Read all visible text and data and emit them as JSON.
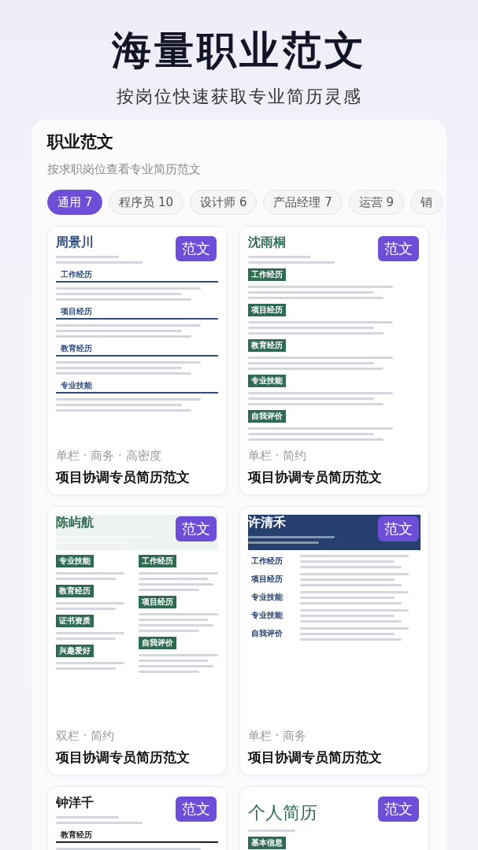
{
  "headline": "海量职业范文",
  "subheadline": "按岗位快速获取专业简历灵感",
  "panel": {
    "title": "职业范文",
    "subtitle": "按求职岗位查看专业简历范文",
    "tabs": [
      {
        "label": "通用 7",
        "selected": true
      },
      {
        "label": "程序员 10",
        "selected": false
      },
      {
        "label": "设计师 6",
        "selected": false
      },
      {
        "label": "产品经理 7",
        "selected": false
      },
      {
        "label": "运营 9",
        "selected": false
      },
      {
        "label": "销",
        "selected": false
      }
    ],
    "templates": [
      {
        "kind": "classic",
        "name": "周景川",
        "color": "#2f4d80",
        "badge": "范文",
        "sections": [
          "工作经历",
          "项目经历",
          "教育经历",
          "专业技能"
        ],
        "tags": "单栏 · 商务 · 高密度",
        "title": "项目协调专员简历范文"
      },
      {
        "kind": "chips",
        "name": "沈雨桐",
        "color": "#2e6b52",
        "badge": "范文",
        "sections": [
          "工作经历",
          "项目经历",
          "教育经历",
          "专业技能",
          "自我评价"
        ],
        "tags": "单栏 · 简约",
        "title": "项目协调专员简历范文"
      },
      {
        "kind": "two-column",
        "name": "陈屿航",
        "color": "#2e6b52",
        "badge": "范文",
        "sections": [
          "专业技能",
          "教育经历",
          "证书资质",
          "兴趣爱好"
        ],
        "side_sections": [
          "工作经历",
          "项目经历",
          "自我评价"
        ],
        "tags": "双栏 · 简约",
        "title": "项目协调专员简历范文"
      },
      {
        "kind": "banner",
        "name": "许清禾",
        "color": "#25406e",
        "badge": "范文",
        "sections": [
          "工作经历",
          "项目经历",
          "专业技能",
          "专业技能",
          "自我评价"
        ],
        "tags": "单栏 · 商务",
        "title": "项目协调专员简历范文"
      },
      {
        "kind": "plain",
        "name": "钟洋千",
        "color": "#222222",
        "badge": "范文",
        "sections": [
          "教育经历"
        ]
      },
      {
        "kind": "headline",
        "name": "个人简历",
        "color": "#2e6b52",
        "badge": "范文",
        "sections": [
          "基本信息"
        ]
      }
    ]
  }
}
